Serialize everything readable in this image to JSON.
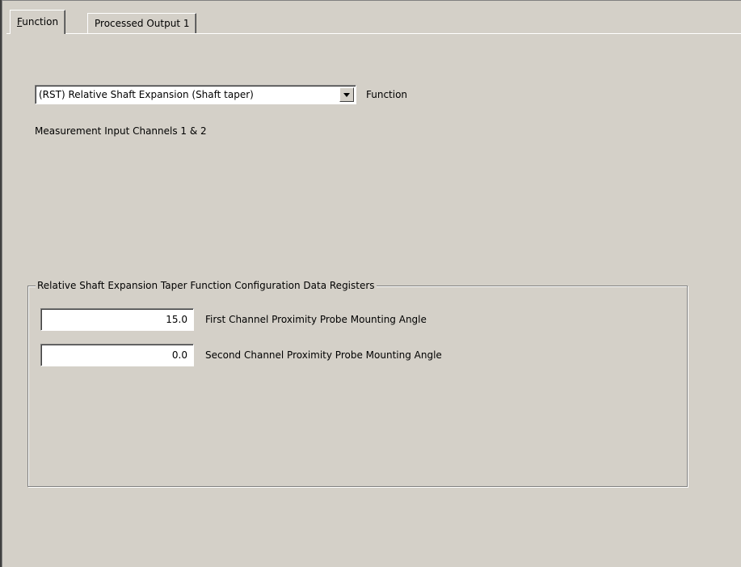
{
  "tabs": {
    "function": {
      "prefix": "",
      "accel": "F",
      "rest": "unction"
    },
    "processed_output": "Processed Output 1"
  },
  "function": {
    "selected_value": "(RST) Relative Shaft Expansion (Shaft taper)",
    "label": "Function",
    "channels_text": "Measurement Input Channels 1 & 2"
  },
  "registers": {
    "title": "Relative Shaft Expansion Taper Function Configuration Data Registers",
    "fields": [
      {
        "value": "15.0",
        "label": "First Channel Proximity Probe Mounting Angle"
      },
      {
        "value": "0.0",
        "label": "Second Channel Proximity Probe Mounting Angle"
      }
    ]
  }
}
